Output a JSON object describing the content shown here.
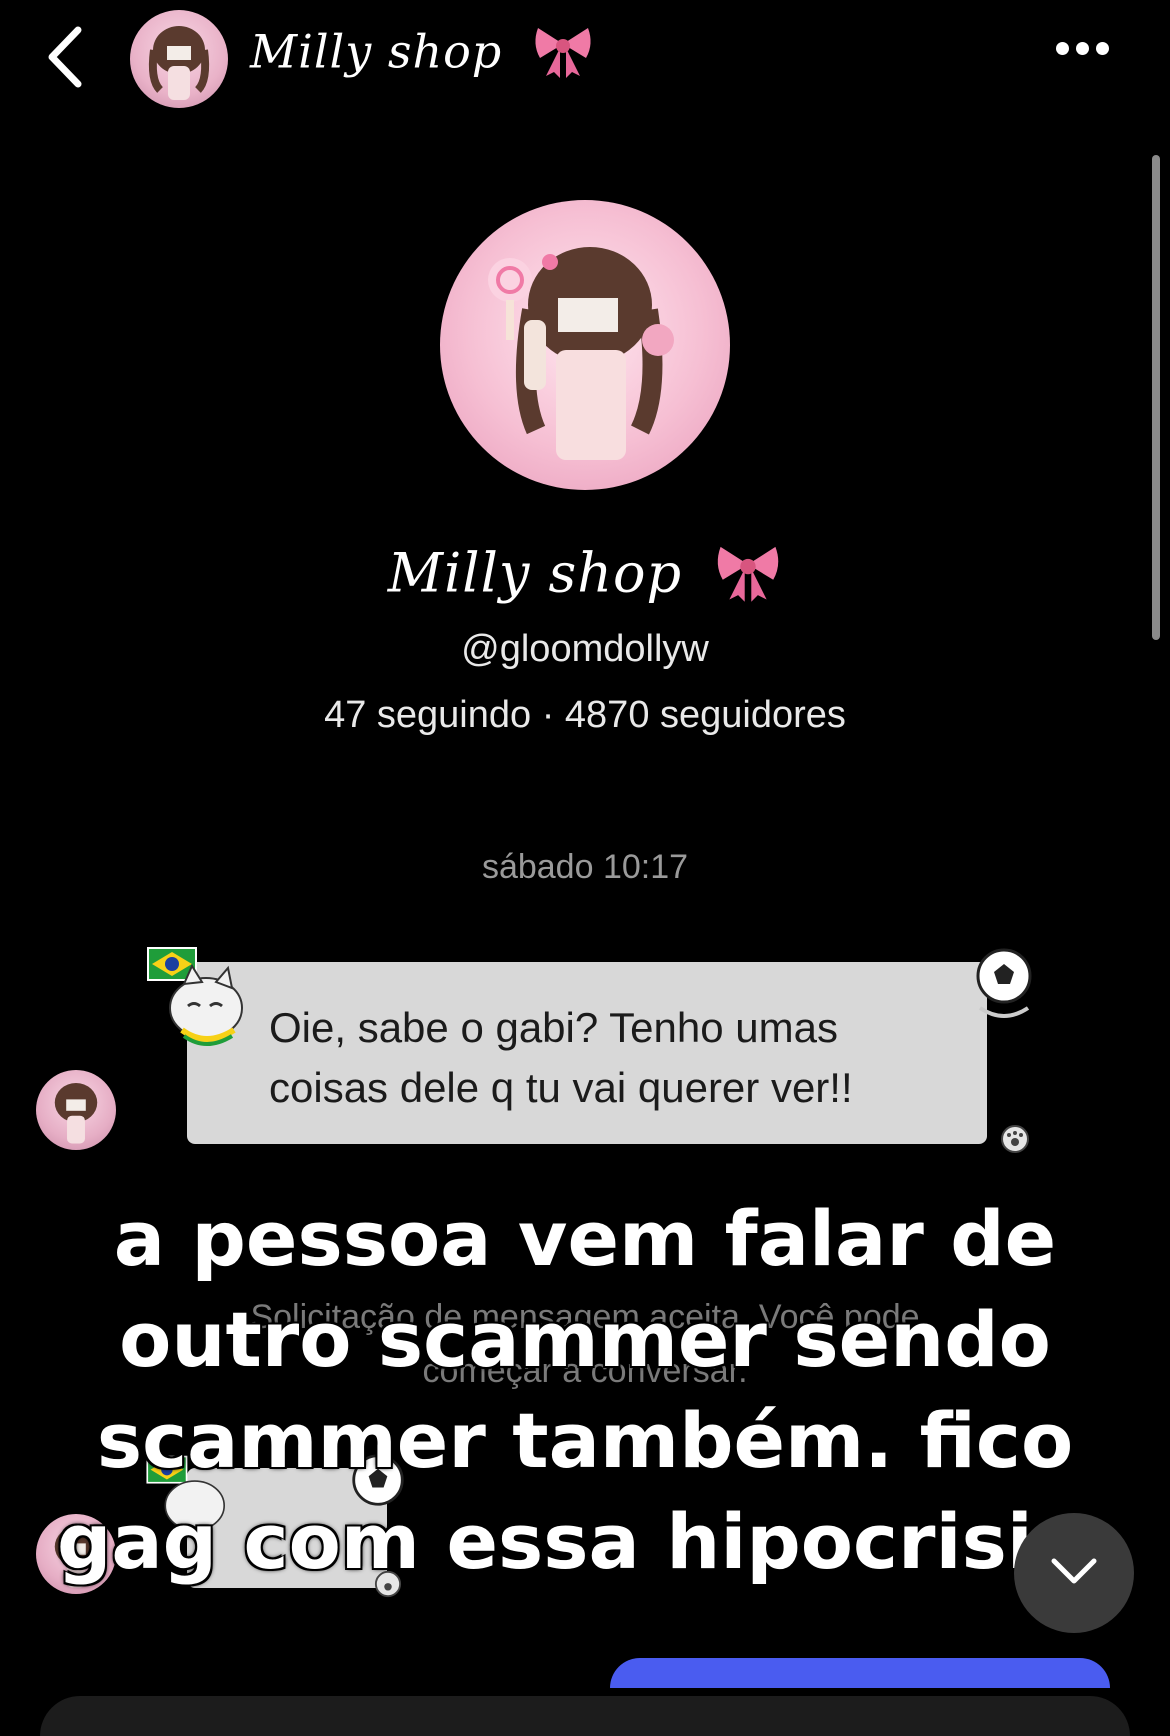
{
  "header": {
    "title": "Milly shop",
    "back_icon": "chevron-left-icon",
    "more_icon": "more-horizontal-icon"
  },
  "profile": {
    "name": "Milly shop",
    "handle": "@gloomdollyw",
    "stats": "47 seguindo · 4870 seguidores"
  },
  "thread": {
    "timestamp": "sábado 10:17",
    "messages": [
      {
        "text_line1": "Oie, sabe o gabi? Tenho umas",
        "text_line2": "coisas dele q tu vai querer ver!!"
      }
    ],
    "system_note_line1": "Solicitação de mensagem aceita. Você pode",
    "system_note_line2": "começar a conversar."
  },
  "overlay": {
    "line1": "a pessoa vem falar de",
    "line2": "outro scammer sendo",
    "line3": "scammer também. fico",
    "line4": "gag com essa hipocrisia."
  },
  "colors": {
    "background": "#000000",
    "bubble": "#d8d8d8",
    "accent_blue": "#4a5cf0",
    "bow_pink": "#f07aa6"
  }
}
